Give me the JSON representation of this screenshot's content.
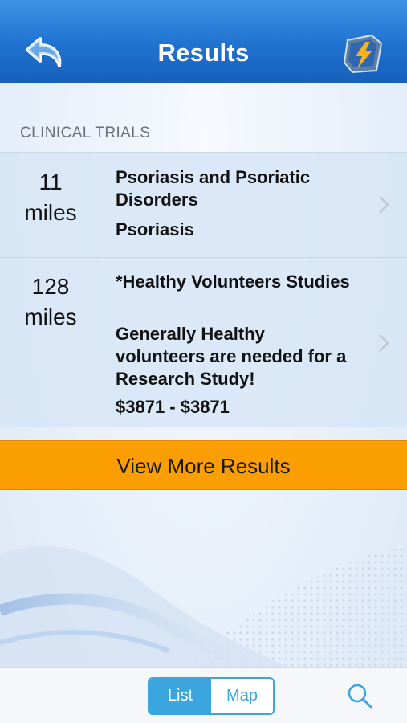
{
  "nav": {
    "title": "Results",
    "back_icon": "back-arrow-icon",
    "logo_icon": "app-logo-icon"
  },
  "section": {
    "header": "CLINICAL TRIALS"
  },
  "results": [
    {
      "distance_num": "11",
      "distance_unit": "miles",
      "title": "Psoriasis and Psoriatic Disorders",
      "subtitle": "Psoriasis",
      "compensation": ""
    },
    {
      "distance_num": "128",
      "distance_unit": "miles",
      "title": "*Healthy Volunteers Studies",
      "subtitle": "Generally Healthy volunteers are needed for a Research Study!",
      "compensation": "$3871 - $3871"
    }
  ],
  "more_button": {
    "label": "View More Results"
  },
  "tabbar": {
    "segments": [
      {
        "label": "List",
        "selected": true
      },
      {
        "label": "Map",
        "selected": false
      }
    ],
    "search_icon": "search-icon"
  },
  "colors": {
    "nav": "#1f72cf",
    "accent": "#3aa6dd",
    "more_button": "#fb9e03"
  }
}
